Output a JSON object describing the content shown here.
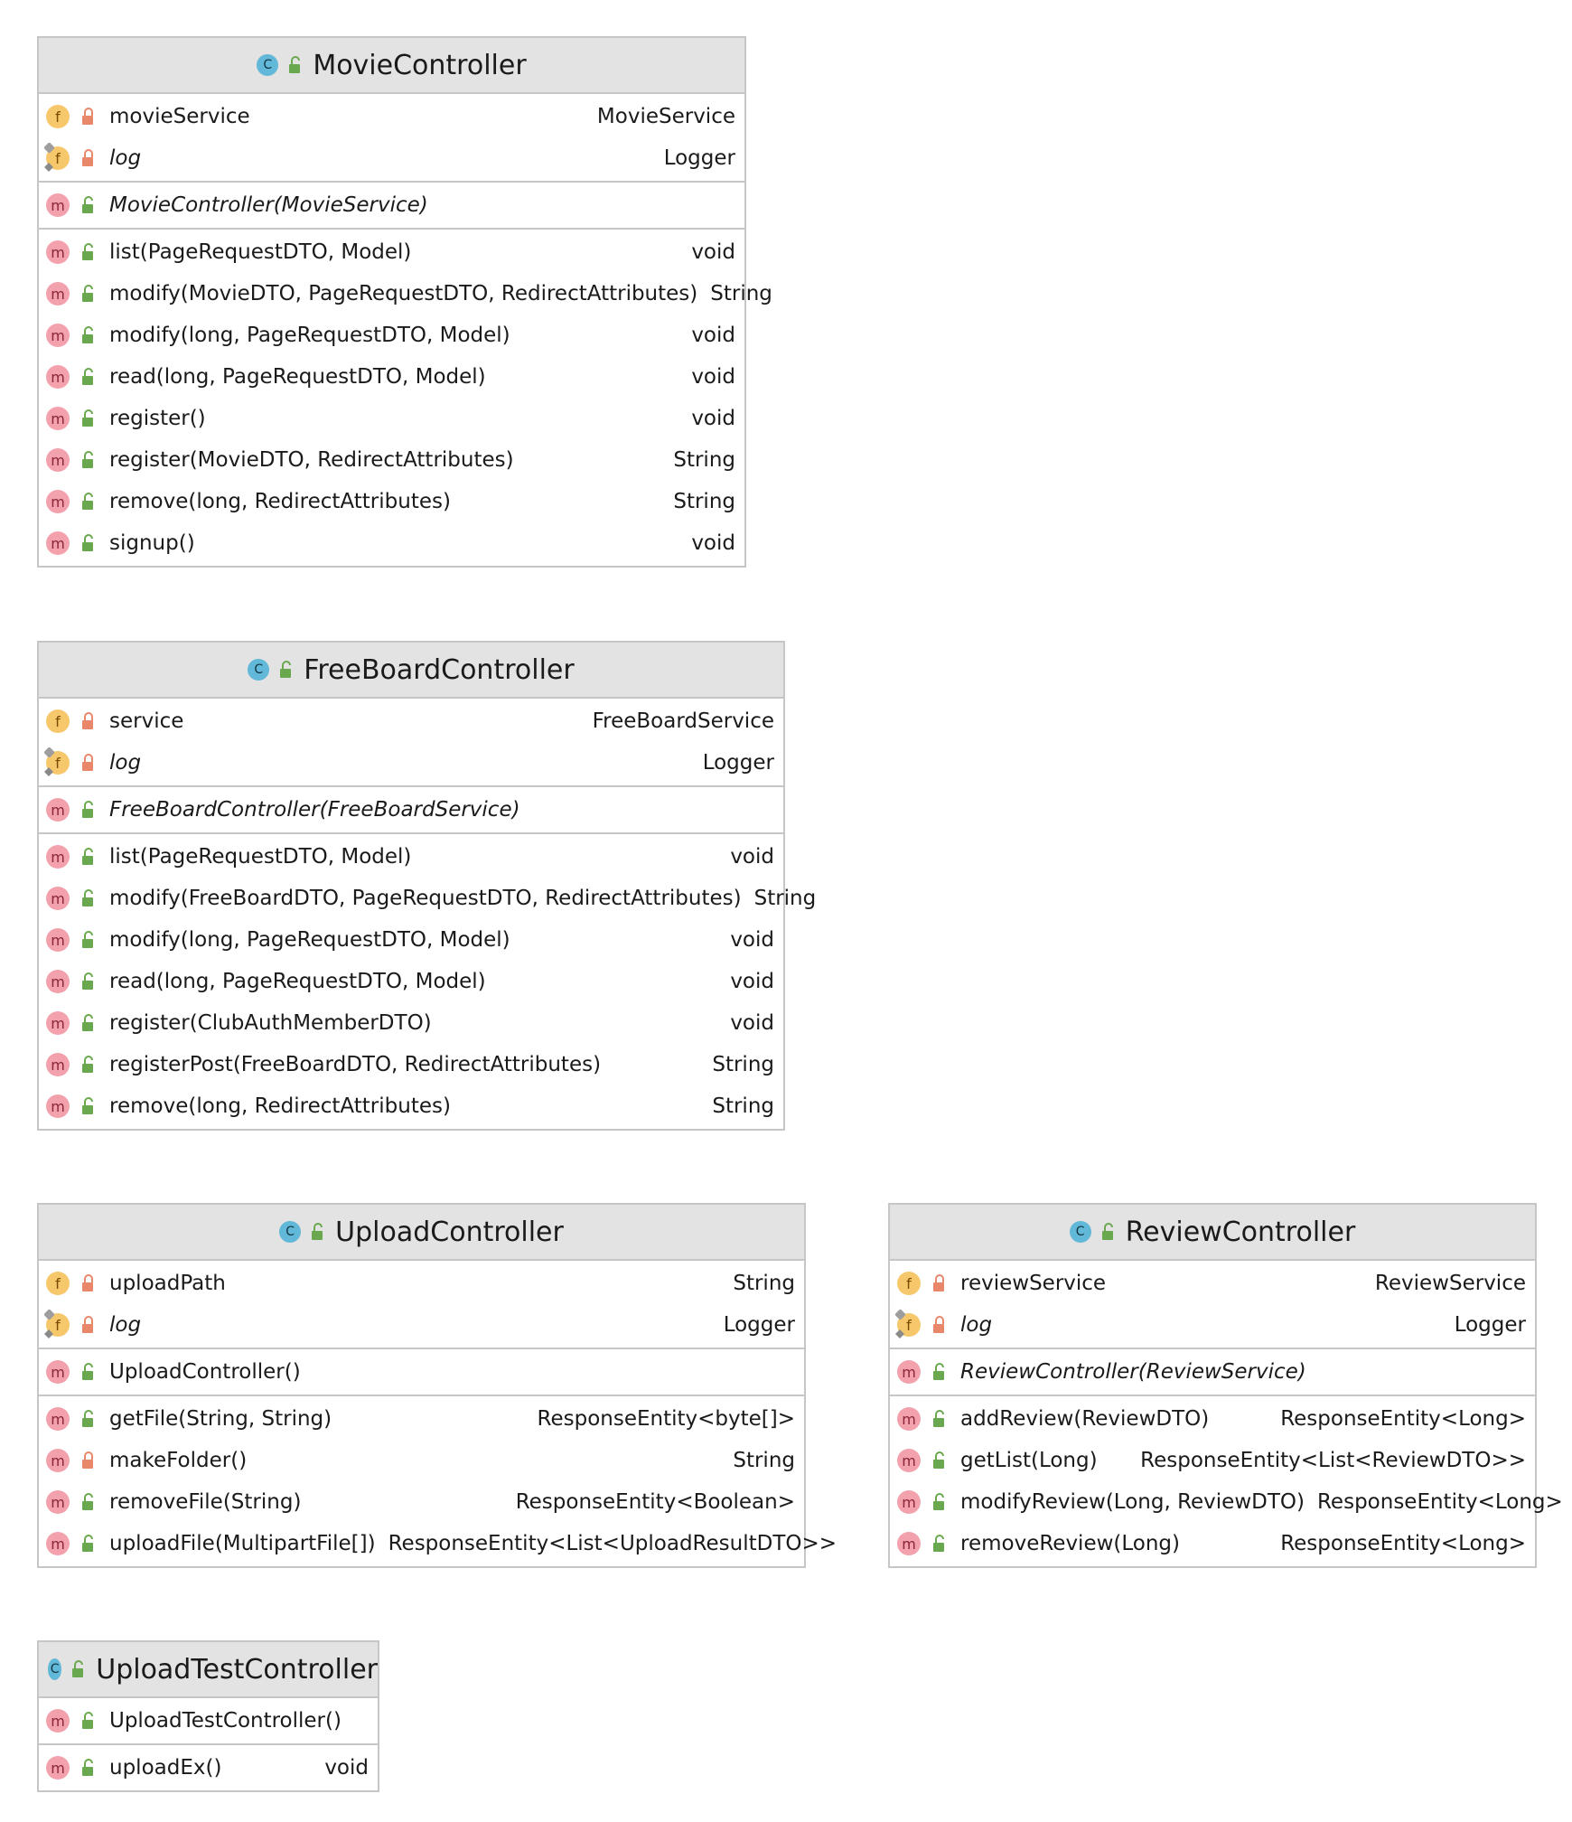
{
  "diagram": {
    "classes": [
      {
        "id": "box-movie",
        "name": "MovieController",
        "class_icon": "C",
        "fields": [
          {
            "icon": "f",
            "static": false,
            "visibility": "private",
            "name": "movieService",
            "type": "MovieService"
          },
          {
            "icon": "f",
            "static": true,
            "visibility": "private",
            "name": "log",
            "type": "Logger",
            "italic": true
          }
        ],
        "constructors": [
          {
            "icon": "m",
            "visibility": "public",
            "name": "MovieController(MovieService)",
            "italic": true
          }
        ],
        "methods": [
          {
            "icon": "m",
            "visibility": "public",
            "name": "list(PageRequestDTO, Model)",
            "type": "void"
          },
          {
            "icon": "m",
            "visibility": "public",
            "name": "modify(MovieDTO, PageRequestDTO, RedirectAttributes)",
            "type": "String"
          },
          {
            "icon": "m",
            "visibility": "public",
            "name": "modify(long, PageRequestDTO, Model)",
            "type": "void"
          },
          {
            "icon": "m",
            "visibility": "public",
            "name": "read(long, PageRequestDTO, Model)",
            "type": "void"
          },
          {
            "icon": "m",
            "visibility": "public",
            "name": "register()",
            "type": "void"
          },
          {
            "icon": "m",
            "visibility": "public",
            "name": "register(MovieDTO, RedirectAttributes)",
            "type": "String"
          },
          {
            "icon": "m",
            "visibility": "public",
            "name": "remove(long, RedirectAttributes)",
            "type": "String"
          },
          {
            "icon": "m",
            "visibility": "public",
            "name": "signup()",
            "type": "void"
          }
        ]
      },
      {
        "id": "box-free",
        "name": "FreeBoardController",
        "class_icon": "C",
        "fields": [
          {
            "icon": "f",
            "static": false,
            "visibility": "private",
            "name": "service",
            "type": "FreeBoardService"
          },
          {
            "icon": "f",
            "static": true,
            "visibility": "private",
            "name": "log",
            "type": "Logger",
            "italic": true
          }
        ],
        "constructors": [
          {
            "icon": "m",
            "visibility": "public",
            "name": "FreeBoardController(FreeBoardService)",
            "italic": true
          }
        ],
        "methods": [
          {
            "icon": "m",
            "visibility": "public",
            "name": "list(PageRequestDTO, Model)",
            "type": "void"
          },
          {
            "icon": "m",
            "visibility": "public",
            "name": "modify(FreeBoardDTO, PageRequestDTO, RedirectAttributes)",
            "type": "String"
          },
          {
            "icon": "m",
            "visibility": "public",
            "name": "modify(long, PageRequestDTO, Model)",
            "type": "void"
          },
          {
            "icon": "m",
            "visibility": "public",
            "name": "read(long, PageRequestDTO, Model)",
            "type": "void"
          },
          {
            "icon": "m",
            "visibility": "public",
            "name": "register(ClubAuthMemberDTO)",
            "type": "void"
          },
          {
            "icon": "m",
            "visibility": "public",
            "name": "registerPost(FreeBoardDTO, RedirectAttributes)",
            "type": "String"
          },
          {
            "icon": "m",
            "visibility": "public",
            "name": "remove(long, RedirectAttributes)",
            "type": "String"
          }
        ]
      },
      {
        "id": "box-upload",
        "name": "UploadController",
        "class_icon": "C",
        "fields": [
          {
            "icon": "f",
            "static": false,
            "visibility": "private",
            "name": "uploadPath",
            "type": "String"
          },
          {
            "icon": "f",
            "static": true,
            "visibility": "private",
            "name": "log",
            "type": "Logger",
            "italic": true
          }
        ],
        "constructors": [
          {
            "icon": "m",
            "visibility": "public",
            "name": "UploadController()",
            "italic": false
          }
        ],
        "methods": [
          {
            "icon": "m",
            "visibility": "public",
            "name": "getFile(String, String)",
            "type": "ResponseEntity<byte[]>"
          },
          {
            "icon": "m",
            "visibility": "private",
            "name": "makeFolder()",
            "type": "String"
          },
          {
            "icon": "m",
            "visibility": "public",
            "name": "removeFile(String)",
            "type": "ResponseEntity<Boolean>"
          },
          {
            "icon": "m",
            "visibility": "public",
            "name": "uploadFile(MultipartFile[])",
            "type": "ResponseEntity<List<UploadResultDTO>>"
          }
        ]
      },
      {
        "id": "box-review",
        "name": "ReviewController",
        "class_icon": "C",
        "fields": [
          {
            "icon": "f",
            "static": false,
            "visibility": "private",
            "name": "reviewService",
            "type": "ReviewService"
          },
          {
            "icon": "f",
            "static": true,
            "visibility": "private",
            "name": "log",
            "type": "Logger",
            "italic": true
          }
        ],
        "constructors": [
          {
            "icon": "m",
            "visibility": "public",
            "name": "ReviewController(ReviewService)",
            "italic": true
          }
        ],
        "methods": [
          {
            "icon": "m",
            "visibility": "public",
            "name": "addReview(ReviewDTO)",
            "type": "ResponseEntity<Long>"
          },
          {
            "icon": "m",
            "visibility": "public",
            "name": "getList(Long)",
            "type": "ResponseEntity<List<ReviewDTO>>"
          },
          {
            "icon": "m",
            "visibility": "public",
            "name": "modifyReview(Long, ReviewDTO)",
            "type": "ResponseEntity<Long>"
          },
          {
            "icon": "m",
            "visibility": "public",
            "name": "removeReview(Long)",
            "type": "ResponseEntity<Long>"
          }
        ]
      },
      {
        "id": "box-uptest",
        "name": "UploadTestController",
        "class_icon": "C",
        "fields": [],
        "constructors": [
          {
            "icon": "m",
            "visibility": "public",
            "name": "UploadTestController()",
            "italic": false
          }
        ],
        "methods": [
          {
            "icon": "m",
            "visibility": "public",
            "name": "uploadEx()",
            "type": "void"
          }
        ]
      }
    ],
    "colors": {
      "header_bg": "#e3e3e3",
      "border": "#c6c6c6",
      "class_icon": "#62b8d8",
      "method_icon": "#f2a1ad",
      "field_icon": "#f6c86b",
      "public_lock": "#6aa84f",
      "private_lock": "#e8876a"
    }
  }
}
